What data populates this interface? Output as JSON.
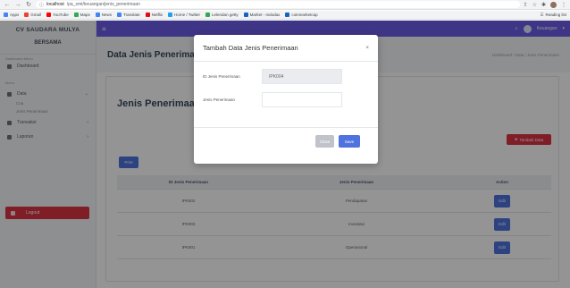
{
  "browser": {
    "url_host": "localhost",
    "url_path": "/pa_smt/keuangan/jenis_penerimaan",
    "reading_list": "Reading list"
  },
  "bookmarks": [
    {
      "label": "Apps",
      "color": "#4285f4"
    },
    {
      "label": "Gmail",
      "color": "#ea4335"
    },
    {
      "label": "YouTube",
      "color": "#ff0000"
    },
    {
      "label": "Maps",
      "color": "#34a853"
    },
    {
      "label": "News",
      "color": "#4285f4"
    },
    {
      "label": "Translate",
      "color": "#4285f4"
    },
    {
      "label": "Netflix",
      "color": "#e50914"
    },
    {
      "label": "Home / Twitter",
      "color": "#1da1f2"
    },
    {
      "label": "Lelendan getty",
      "color": "#34a853"
    },
    {
      "label": "Market - Indodax",
      "color": "#1565c0"
    },
    {
      "label": "coinmarketcap",
      "color": "#1565c0"
    }
  ],
  "sidebar": {
    "brand_name": "CV SAUDARA MULYA",
    "brand_sub": "BERSAMA",
    "caption_main": "Dashboard Menu",
    "dashboard": "Dashboard",
    "caption_data": "Menu",
    "data": "Data",
    "sub_items": [
      "Coa",
      "Jenis Penerimaan"
    ],
    "transaksi": "Transaksi",
    "laporan": "Laporan",
    "logout": "Logout"
  },
  "topnav": {
    "user": "Keuangan"
  },
  "content": {
    "page_title": "Data Jenis Penerimaan",
    "breadcrumb": "Dashboard / Data / Jenis Penerimaan",
    "card_title": "Jenis Penerimaan",
    "btn_tambah": "Tambah Data",
    "btn_print": "Print"
  },
  "table": {
    "headers": [
      "ID Jenis Penerimaan",
      "Jenis Penerimaan",
      "Action"
    ],
    "rows": [
      {
        "id": "IPK002",
        "name": "Pendapatan",
        "action": "Edit"
      },
      {
        "id": "IPK003",
        "name": "Investasi",
        "action": "Edit"
      },
      {
        "id": "IPK001",
        "name": "Operasional",
        "action": "Edit"
      }
    ]
  },
  "modal": {
    "title": "Tambah Data Jenis Penerimaan",
    "close_symbol": "×",
    "id_label": "ID Jenis Penerimaan",
    "id_value": "IPK004",
    "name_label": "Jenis Penerimaan",
    "name_value": "",
    "btn_close": "Close",
    "btn_save": "Save"
  },
  "colors": {
    "primary": "#6c5ce7",
    "button_blue": "#4e73df",
    "danger": "#dc3545"
  }
}
